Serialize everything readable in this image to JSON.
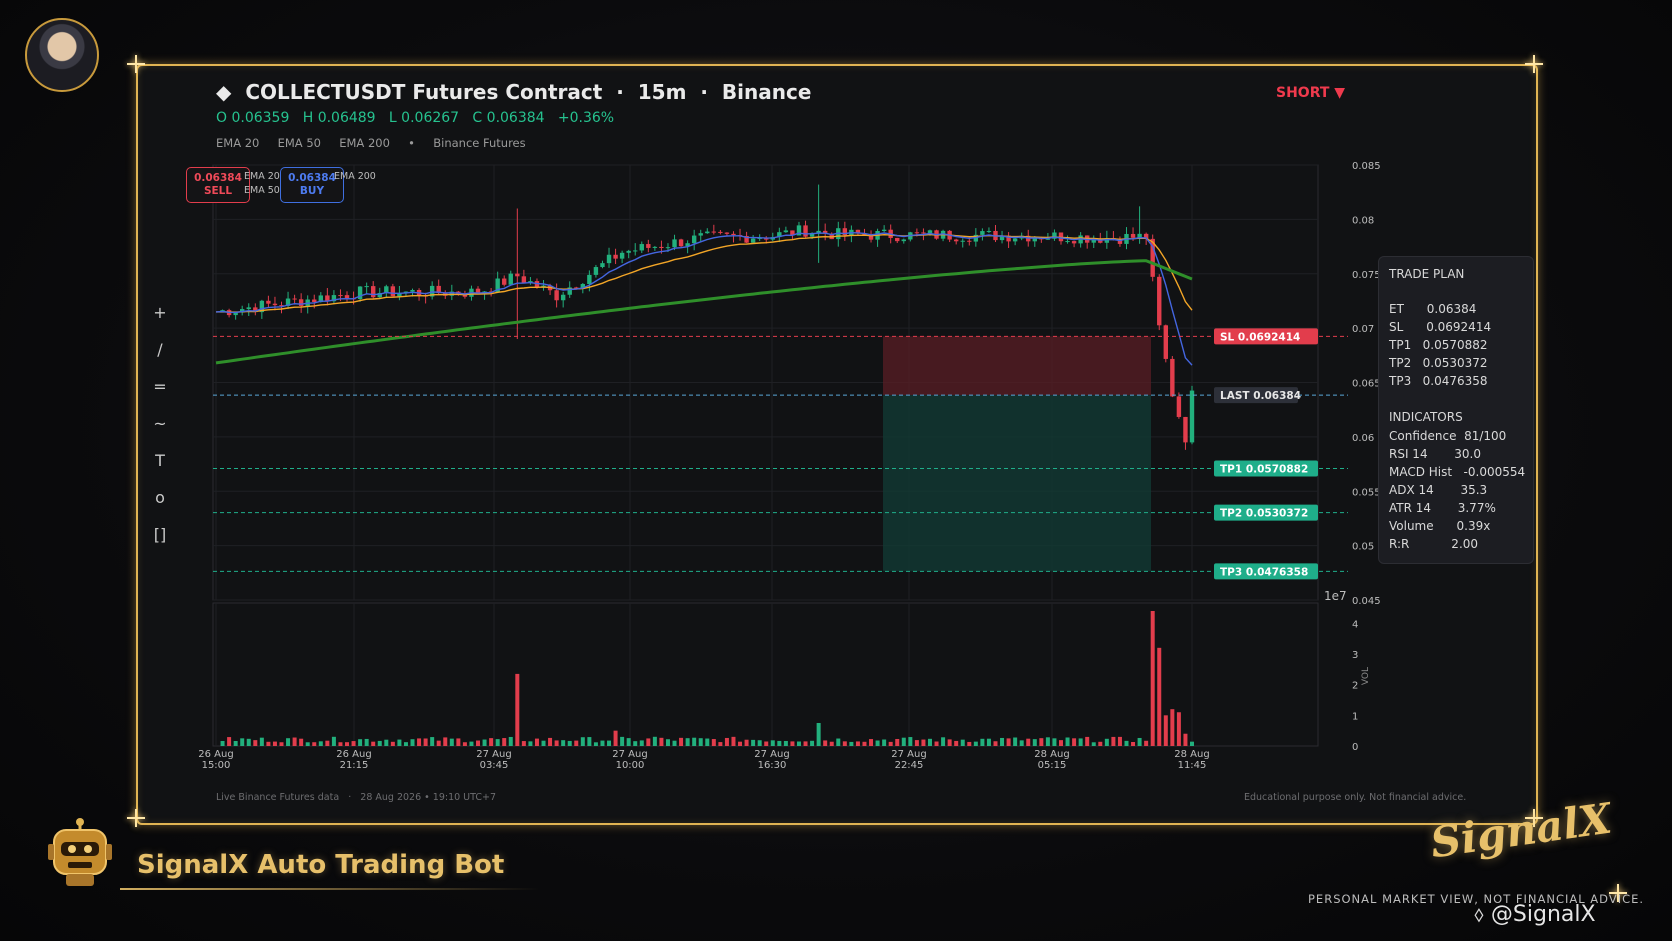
{
  "header": {
    "diamond": "◆",
    "title": "COLLECTUSDT Futures Contract  ·  15m  ·  Binance",
    "ohlc": "O 0.06359   H 0.06489   L 0.06267   C 0.06384   +0.36%",
    "indicators_row": "EMA 20     EMA 50     EMA 200     •     Binance Futures",
    "side": "SHORT ▼"
  },
  "quote": {
    "sell_price": "0.06384",
    "sell_label": "SELL",
    "buy_price": "0.06384",
    "buy_label": "BUY",
    "legend_ema20": "EMA 20",
    "legend_ema50": "EMA 50",
    "legend_ema200": "EMA 200"
  },
  "toolbox": [
    "+",
    "/",
    "=",
    "~",
    "T",
    "o",
    "[]"
  ],
  "trade_plan": {
    "title": "TRADE PLAN",
    "rows": [
      "ET      0.06384",
      "SL      0.0692414",
      "TP1   0.0570882",
      "TP2   0.0530372",
      "TP3   0.0476358"
    ],
    "indicators_title": "INDICATORS",
    "indicators": [
      "Confidence  81/100",
      "RSI 14       30.0",
      "MACD Hist   -0.000554",
      "ADX 14       35.3",
      "ATR 14       3.77%",
      "Volume      0.39x",
      "R:R           2.00"
    ]
  },
  "footer": {
    "left": "Live Binance Futures data   ·   28 Aug 2026 • 19:10 UTC+7",
    "right": "Educational purpose only. Not financial advice."
  },
  "branding": {
    "bot_name": "SignalX Auto Trading Bot",
    "logo_text": "SignalX",
    "disclaimer": "PERSONAL MARKET VIEW, NOT FINANCIAL ADVICE.",
    "handle": "@SignalX"
  },
  "colors": {
    "bull": "#22b07d",
    "bear": "#e23d4c",
    "ema20": "#4466e0",
    "ema50": "#f2a527",
    "ema200": "#2f8f2a",
    "sl": "#e23d4c",
    "tp": "#1fae8a",
    "last": "#5aa7d8",
    "gold": "#e0b453"
  },
  "chart_data": {
    "type": "candlestick",
    "symbol": "COLLECTUSDT",
    "interval": "15m",
    "ylim": [
      0.045,
      0.085
    ],
    "y_ticks": [
      0.045,
      0.05,
      0.055,
      0.06,
      0.065,
      0.07,
      0.075,
      0.08,
      0.085
    ],
    "y_tick_labels": [
      "0.045",
      "0.05",
      "0.055",
      "0.06",
      "0.065",
      "0.07",
      "0.075",
      "0.08",
      "0.085"
    ],
    "offset_label": "1e7",
    "x_tick_labels": [
      [
        "26 Aug",
        "15:00"
      ],
      [
        "26 Aug",
        "21:15"
      ],
      [
        "27 Aug",
        "03:45"
      ],
      [
        "27 Aug",
        "10:00"
      ],
      [
        "27 Aug",
        "16:30"
      ],
      [
        "27 Aug",
        "22:45"
      ],
      [
        "28 Aug",
        "05:15"
      ],
      [
        "28 Aug",
        "11:45"
      ]
    ],
    "levels": [
      {
        "name": "SL",
        "value": 0.0692414,
        "label": "SL  0.0692414"
      },
      {
        "name": "LAST",
        "value": 0.06384,
        "label": "LAST  0.06384"
      },
      {
        "name": "TP1",
        "value": 0.0570882,
        "label": "TP1  0.0570882"
      },
      {
        "name": "TP2",
        "value": 0.0530372,
        "label": "TP2  0.0530372"
      },
      {
        "name": "TP3",
        "value": 0.0476358,
        "label": "TP3  0.0476358"
      }
    ],
    "ema_series": [
      {
        "name": "EMA 20",
        "start": 0.0718,
        "end": 0.0688
      },
      {
        "name": "EMA 50",
        "start": 0.0705,
        "end": 0.0733
      },
      {
        "name": "EMA 200",
        "start": 0.0668,
        "end": 0.0745
      }
    ],
    "volume": {
      "ylabel": "VOL",
      "y_ticks": [
        0,
        1,
        2,
        3,
        4
      ],
      "y_tick_labels": [
        "0",
        "1",
        "2",
        "3",
        "4"
      ]
    }
  }
}
